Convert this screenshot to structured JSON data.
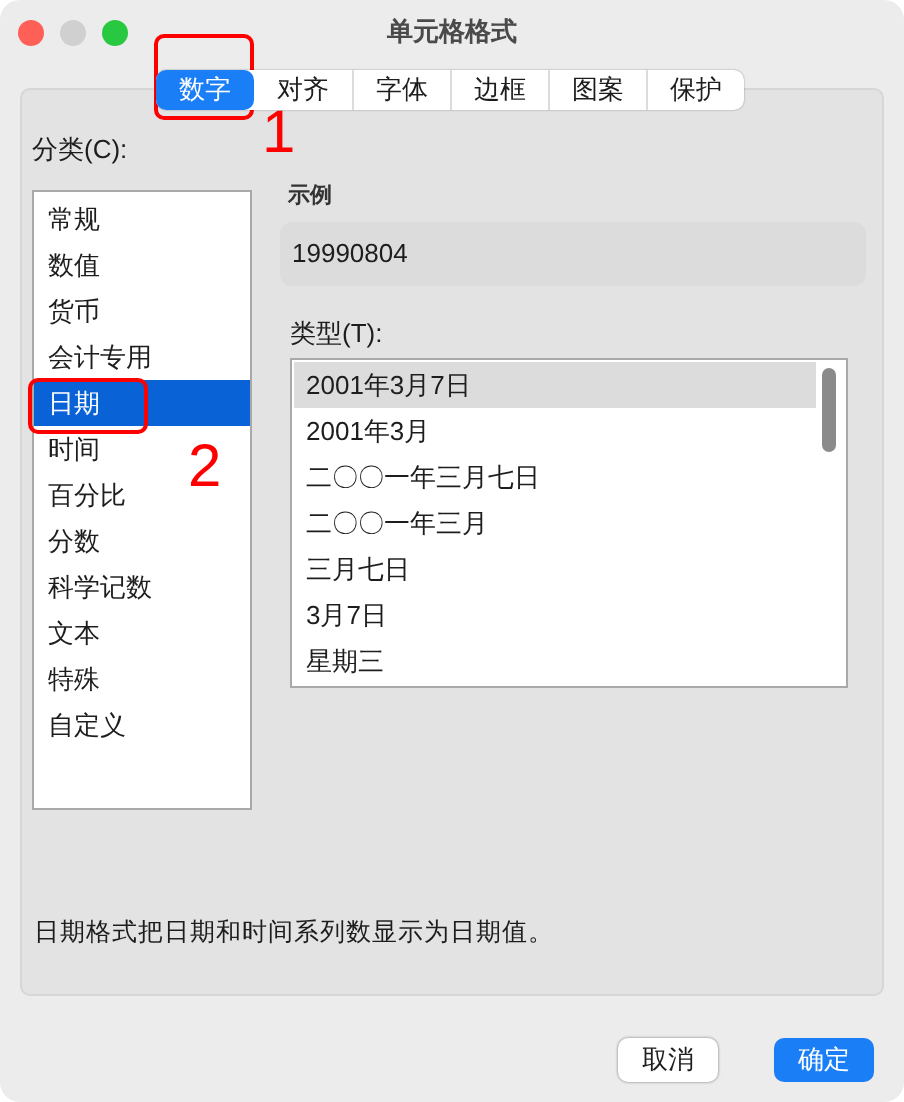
{
  "window": {
    "title": "单元格格式"
  },
  "tabs": [
    {
      "label": "数字",
      "selected": true
    },
    {
      "label": "对齐",
      "selected": false
    },
    {
      "label": "字体",
      "selected": false
    },
    {
      "label": "边框",
      "selected": false
    },
    {
      "label": "图案",
      "selected": false
    },
    {
      "label": "保护",
      "selected": false
    }
  ],
  "category": {
    "label": "分类(C):",
    "items": [
      {
        "label": "常规",
        "selected": false
      },
      {
        "label": "数值",
        "selected": false
      },
      {
        "label": "货币",
        "selected": false
      },
      {
        "label": "会计专用",
        "selected": false
      },
      {
        "label": "日期",
        "selected": true
      },
      {
        "label": "时间",
        "selected": false
      },
      {
        "label": "百分比",
        "selected": false
      },
      {
        "label": "分数",
        "selected": false
      },
      {
        "label": "科学记数",
        "selected": false
      },
      {
        "label": "文本",
        "selected": false
      },
      {
        "label": "特殊",
        "selected": false
      },
      {
        "label": "自定义",
        "selected": false
      }
    ]
  },
  "sample": {
    "label": "示例",
    "value": "19990804"
  },
  "type": {
    "label": "类型(T):",
    "items": [
      {
        "label": "2001年3月7日",
        "selected": true
      },
      {
        "label": "2001年3月",
        "selected": false
      },
      {
        "label": "二〇〇一年三月七日",
        "selected": false
      },
      {
        "label": "二〇〇一年三月",
        "selected": false
      },
      {
        "label": "三月七日",
        "selected": false
      },
      {
        "label": "3月7日",
        "selected": false
      },
      {
        "label": "星期三",
        "selected": false
      }
    ]
  },
  "description": "日期格式把日期和时间系列数显示为日期值。",
  "buttons": [
    {
      "label": "取消",
      "kind": "default"
    },
    {
      "label": "确定",
      "kind": "primary"
    }
  ],
  "annotations": [
    {
      "label": "1"
    },
    {
      "label": "2"
    }
  ]
}
